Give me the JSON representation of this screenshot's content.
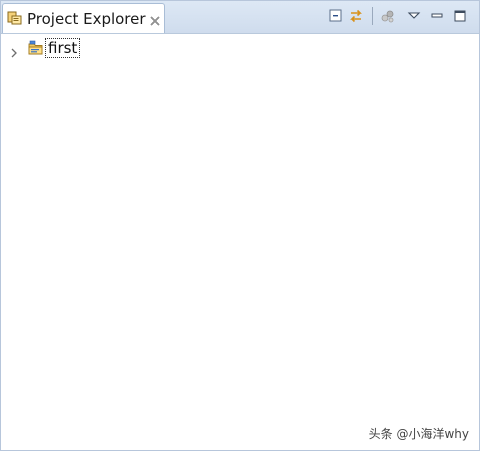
{
  "view": {
    "tab_title": "Project Explorer",
    "tab_icon": "project-explorer-icon",
    "toolbar": [
      {
        "name": "collapse-all-icon"
      },
      {
        "name": "link-with-editor-icon"
      },
      {
        "name": "filter-icon"
      },
      {
        "name": "view-menu-icon"
      },
      {
        "name": "minimize-icon"
      },
      {
        "name": "maximize-icon"
      }
    ]
  },
  "tree": {
    "items": [
      {
        "label": "first",
        "icon": "project-folder-icon",
        "expanded": false
      }
    ]
  },
  "watermark": {
    "text": "头条 @小海洋why"
  },
  "colors": {
    "tab_bar_bg": "#cfdced",
    "border": "#b7c6db",
    "accent_orange": "#e8a13a",
    "accent_blue": "#3b73c4"
  }
}
